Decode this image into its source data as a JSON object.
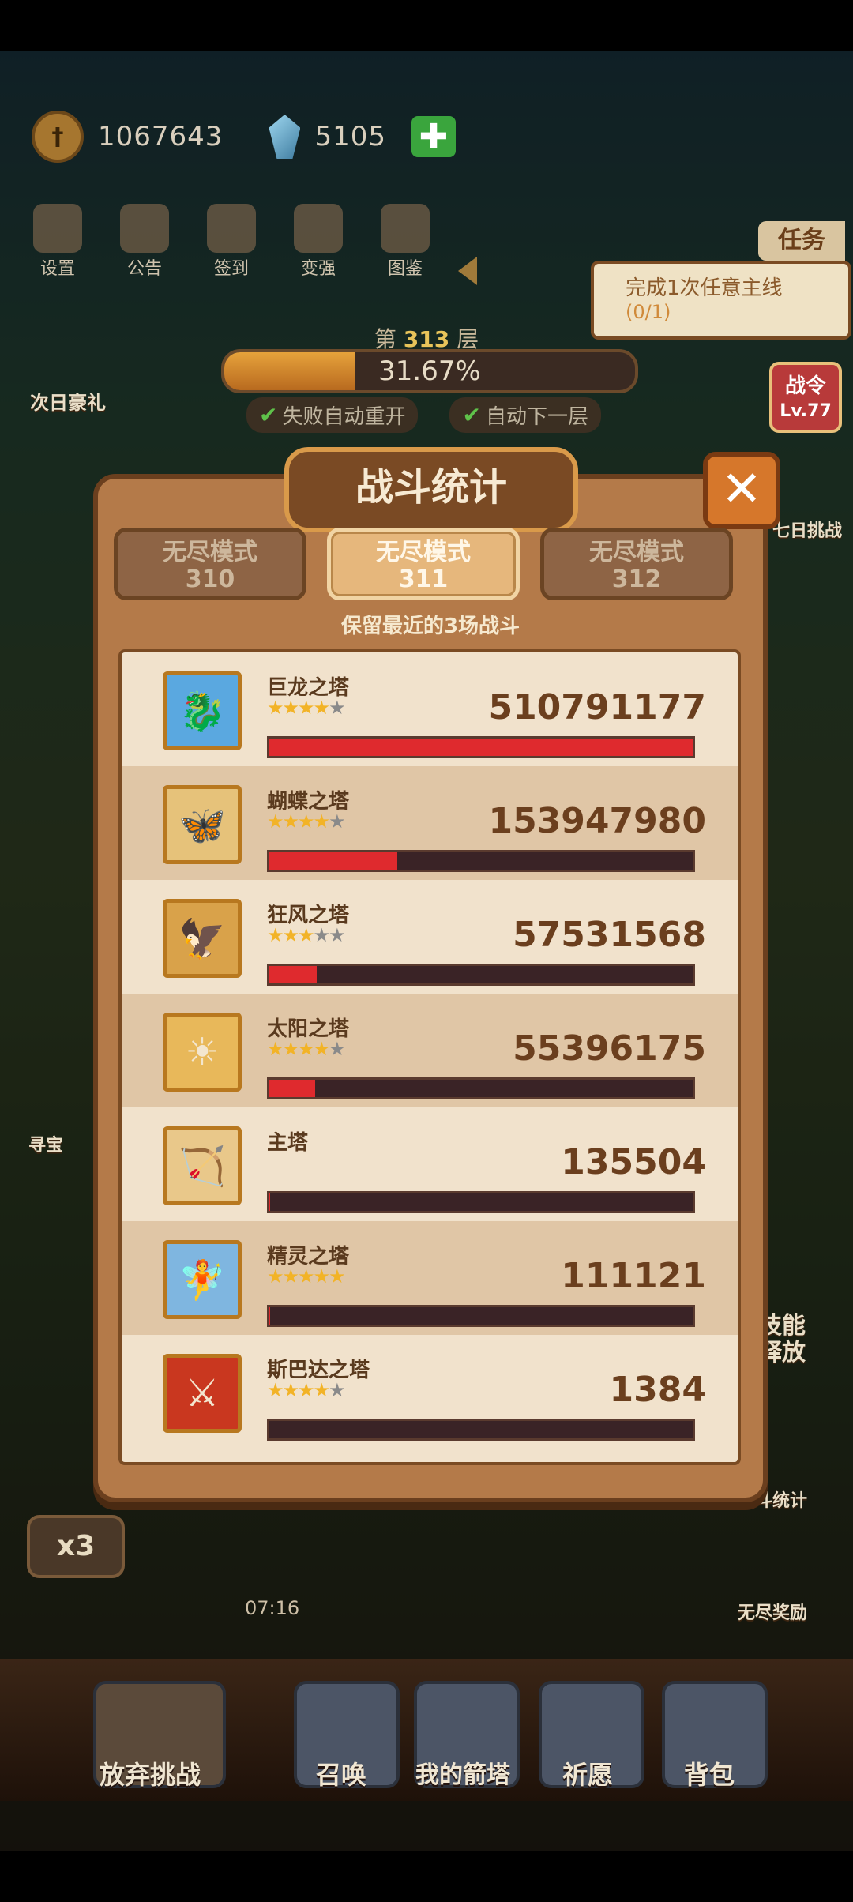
{
  "hud": {
    "coins": "1067643",
    "gems": "5105",
    "plus_label": "✚"
  },
  "menu": [
    "设置",
    "公告",
    "签到",
    "变强",
    "图鉴"
  ],
  "quest": {
    "tab": "任务",
    "text": "完成1次任意主线",
    "progress": "(0/1)"
  },
  "floor": {
    "prefix": "第",
    "number": "313",
    "suffix": "层",
    "percent_text": "31.67%",
    "percent": 0.3167
  },
  "toggles": [
    "失败自动重开",
    "自动下一层"
  ],
  "side": {
    "gift": "次日豪礼",
    "battle_pass": "战令",
    "battle_pass_level": "Lv.77",
    "seven_day": "七日挑战",
    "treasure": "寻宝",
    "stats": "战斗统计",
    "endless_reward": "无尽奖励",
    "skill_release": "技能释放"
  },
  "speed": "x3",
  "timer": "07:16",
  "panel": {
    "title": "战斗统计",
    "close": "✕",
    "tabs": [
      {
        "mode": "无尽模式",
        "number": "310",
        "active": false
      },
      {
        "mode": "无尽模式",
        "number": "311",
        "active": true
      },
      {
        "mode": "无尽模式",
        "number": "312",
        "active": false
      }
    ],
    "note": "保留最近的3场战斗",
    "rows": [
      {
        "name": "巨龙之塔",
        "stars": 4,
        "damage": "510791177",
        "ratio": 1.0,
        "avatar_color": "#5aa8e0",
        "avatar_glyph": "🐉"
      },
      {
        "name": "蝴蝶之塔",
        "stars": 4,
        "damage": "153947980",
        "ratio": 0.3014,
        "avatar_color": "#e6c27a",
        "avatar_glyph": "🦋"
      },
      {
        "name": "狂风之塔",
        "stars": 3,
        "damage": "57531568",
        "ratio": 0.1126,
        "avatar_color": "#d9a24a",
        "avatar_glyph": "🦅"
      },
      {
        "name": "太阳之塔",
        "stars": 4,
        "damage": "55396175",
        "ratio": 0.1085,
        "avatar_color": "#e8b85a",
        "avatar_glyph": "☀"
      },
      {
        "name": "主塔",
        "stars": 0,
        "damage": "135504",
        "ratio": 0.0003,
        "avatar_color": "#e9c88a",
        "avatar_glyph": "🏹"
      },
      {
        "name": "精灵之塔",
        "stars": 5,
        "damage": "111121",
        "ratio": 0.0002,
        "avatar_color": "#7fb6e0",
        "avatar_glyph": "🧚"
      },
      {
        "name": "斯巴达之塔",
        "stars": 4,
        "damage": "1384",
        "ratio": 0.0,
        "avatar_color": "#c9371f",
        "avatar_glyph": "⚔"
      }
    ]
  },
  "bottom": [
    "放弃挑战",
    "召唤",
    "我的箭塔",
    "祈愿",
    "背包"
  ]
}
